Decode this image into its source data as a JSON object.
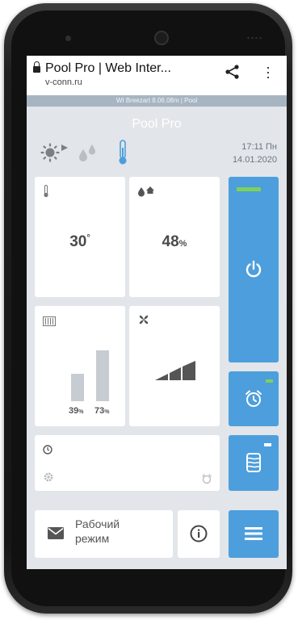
{
  "browser": {
    "page_title": "Pool Pro | Web Inter...",
    "url": "v-conn.ru"
  },
  "app": {
    "status_line": "WI Breezart 8.06.08m | Pool",
    "title": "Pool Pro",
    "time": "17:11 Пн",
    "date": "14.01.2020"
  },
  "tiles": {
    "temperature": {
      "value": "30",
      "unit": "°"
    },
    "humidity": {
      "value": "48",
      "unit": "%"
    },
    "filters": {
      "bar1": "39",
      "bar2": "73",
      "unit": "%",
      "bar1_level": 0.39,
      "bar2_level": 0.73
    },
    "fan": {
      "level": 2,
      "max_level": 3
    }
  },
  "mode": {
    "label_line1": "Рабочий",
    "label_line2": "режим"
  },
  "colors": {
    "accent": "#4d9edc",
    "indicator": "#7cd15a",
    "background": "#e2e5e9"
  },
  "icons": [
    "lock-icon",
    "share-icon",
    "more-vert-icon",
    "sun-icon",
    "drops-icon",
    "thermometer-icon",
    "fan-icon",
    "power-icon",
    "alarm-clock-icon",
    "clock-icon",
    "gear-icon",
    "heater-icon",
    "mail-icon",
    "info-icon",
    "hamburger-icon"
  ]
}
